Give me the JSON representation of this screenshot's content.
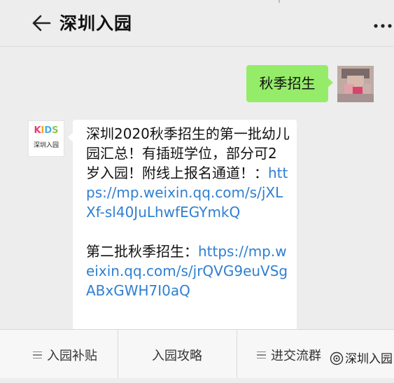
{
  "header": {
    "title": "深圳入园",
    "back_icon": "arrow-left-icon",
    "more_icon": "more-dots-icon"
  },
  "messages": {
    "outgoing": {
      "text": "秋季招生"
    },
    "incoming": {
      "avatar_logo": [
        "K",
        "I",
        "D",
        "S"
      ],
      "avatar_logo_colors": [
        "#e83e6b",
        "#f5a623",
        "#45b0e6",
        "#8bc34a"
      ],
      "avatar_sub": "深圳入园",
      "intro": "深圳2020秋季招生的第一批幼儿园汇总！有插班学位，部分可2岁入园！附线上报名通道！：",
      "link1": "https://mp.weixin.qq.com/s/jXLXf-sl40JuLhwfEGYmkQ",
      "second_label": "第二批秋季招生：",
      "link2": "https://mp.weixin.qq.com/s/jrQVG9euVSgABxGWH7I0aQ"
    }
  },
  "menu": {
    "items": [
      {
        "label": "入园补贴",
        "icon": "menu-list-icon"
      },
      {
        "label": "入园攻略",
        "icon": ""
      },
      {
        "label": "进交流群",
        "icon": "menu-list-icon"
      }
    ]
  },
  "watermark": {
    "text": "深圳入园",
    "icon": "wechat-channel-icon"
  },
  "colors": {
    "outgoing_bubble": "#95ec69",
    "link": "#2f7fd1",
    "background": "#ededed"
  }
}
